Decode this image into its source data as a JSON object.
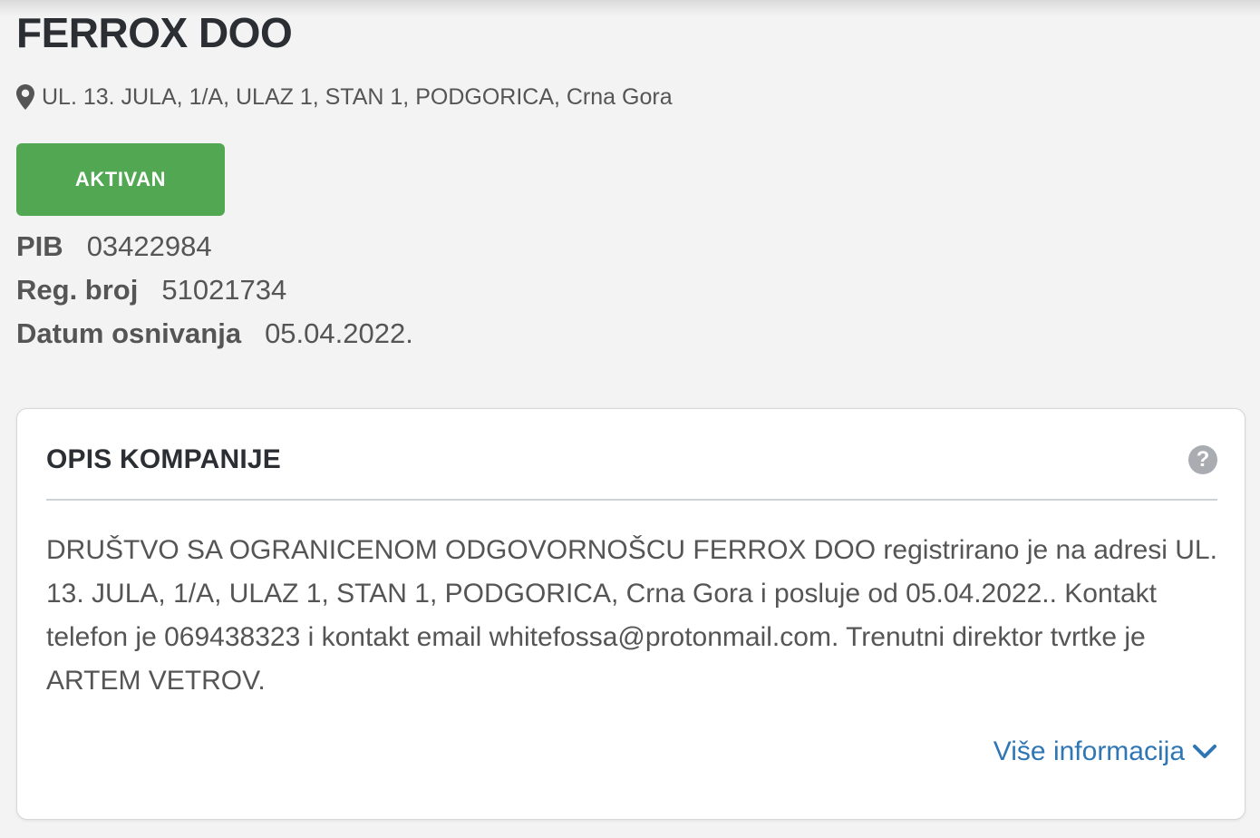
{
  "company": {
    "name": "FERROX DOO",
    "address": "UL. 13. JULA, 1/A, ULAZ 1, STAN 1, PODGORICA, Crna Gora",
    "status": "AKTIVAN"
  },
  "info": {
    "pib_label": "PIB",
    "pib_value": "03422984",
    "reg_label": "Reg. broj",
    "reg_value": "51021734",
    "date_label": "Datum osnivanja",
    "date_value": "05.04.2022."
  },
  "description_card": {
    "title": "OPIS KOMPANIJE",
    "help_icon_glyph": "?",
    "text": "DRUŠTVO SA OGRANICENOM ODGOVORNOŠCU FERROX DOO registrirano je na adresi UL. 13. JULA, 1/A, ULAZ 1, STAN 1, PODGORICA, Crna Gora i posluje od 05.04.2022.. Kontakt telefon je 069438323 i kontakt email whitefossa@protonmail.com. Trenutni direktor tvrtke je ARTEM VETROV.",
    "more_info_label": "Više informacija"
  },
  "icons": {
    "address": "map-pin-icon",
    "help": "question-circle-icon",
    "expand": "chevron-down-icon"
  },
  "colors": {
    "status_green": "#52a752",
    "link_blue": "#2f76b5",
    "help_gray": "#a9adb1"
  }
}
